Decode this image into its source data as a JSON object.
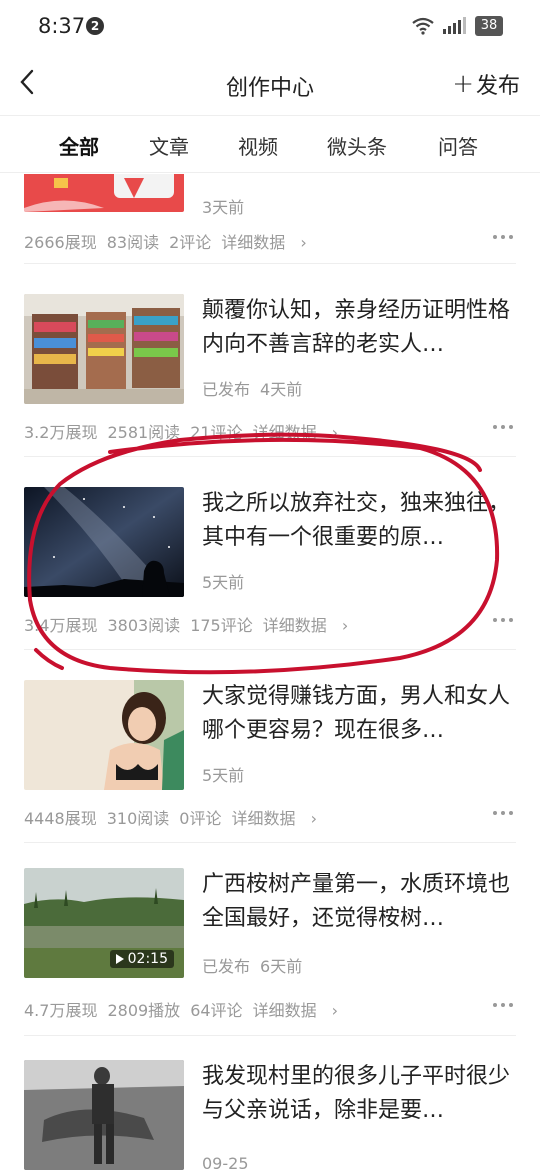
{
  "status_bar": {
    "time": "8:37",
    "notification_count": "2",
    "battery": "38"
  },
  "header": {
    "title": "创作中心",
    "publish_label": "发布"
  },
  "tabs": [
    "全部",
    "文章",
    "视频",
    "微头条",
    "问答"
  ],
  "items": [
    {
      "title": "",
      "status": "",
      "time": "3天前",
      "views": "2666展现",
      "reads": "83阅读",
      "comments": "2评论",
      "detail": "详细数据",
      "duration": ""
    },
    {
      "title": "颠覆你认知，亲身经历证明性格内向不善言辞的老实人…",
      "status": "已发布",
      "time": "4天前",
      "views": "3.2万展现",
      "reads": "2581阅读",
      "comments": "21评论",
      "detail": "详细数据",
      "duration": ""
    },
    {
      "title": "我之所以放弃社交，独来独往，其中有一个很重要的原…",
      "status": "",
      "time": "5天前",
      "views": "3.4万展现",
      "reads": "3803阅读",
      "comments": "175评论",
      "detail": "详细数据",
      "duration": ""
    },
    {
      "title": "大家觉得赚钱方面，男人和女人哪个更容易？现在很多…",
      "status": "",
      "time": "5天前",
      "views": "4448展现",
      "reads": "310阅读",
      "comments": "0评论",
      "detail": "详细数据",
      "duration": ""
    },
    {
      "title": "广西桉树产量第一，水质环境也全国最好，还觉得桉树…",
      "status": "已发布",
      "time": "6天前",
      "views": "4.7万展现",
      "reads": "2809播放",
      "comments": "64评论",
      "detail": "详细数据",
      "duration": "02:15"
    },
    {
      "title": "我发现村里的很多儿子平时很少与父亲说话，除非是要…",
      "status": "",
      "time": "09-25",
      "views": "",
      "reads": "",
      "comments": "",
      "detail": "",
      "duration": ""
    }
  ],
  "colors": {
    "annotation": "#c8102e",
    "text": "#222222",
    "muted": "#999999"
  }
}
